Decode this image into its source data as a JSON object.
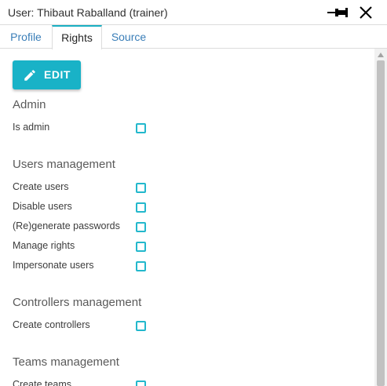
{
  "window": {
    "title": "User: Thibaut Raballand (trainer)",
    "icons": {
      "pin": "pin-icon",
      "close": "close-icon"
    }
  },
  "tabs": [
    {
      "label": "Profile",
      "active": false
    },
    {
      "label": "Rights",
      "active": true
    },
    {
      "label": "Source",
      "active": false
    }
  ],
  "edit_button": {
    "label": "EDIT",
    "icon": "pencil-icon"
  },
  "sections": [
    {
      "title": "Admin",
      "items": [
        {
          "label": "Is admin",
          "checked": false
        }
      ]
    },
    {
      "title": "Users management",
      "items": [
        {
          "label": "Create users",
          "checked": false
        },
        {
          "label": "Disable users",
          "checked": false
        },
        {
          "label": "(Re)generate passwords",
          "checked": false
        },
        {
          "label": "Manage rights",
          "checked": false
        },
        {
          "label": "Impersonate users",
          "checked": false
        }
      ]
    },
    {
      "title": "Controllers management",
      "items": [
        {
          "label": "Create controllers",
          "checked": false
        }
      ]
    },
    {
      "title": "Teams management",
      "items": [
        {
          "label": "Create teams",
          "checked": false
        }
      ]
    }
  ],
  "colors": {
    "accent": "#19b2c7",
    "tab_link": "#3a7eb8",
    "checkbox_border": "#23b8cc"
  }
}
